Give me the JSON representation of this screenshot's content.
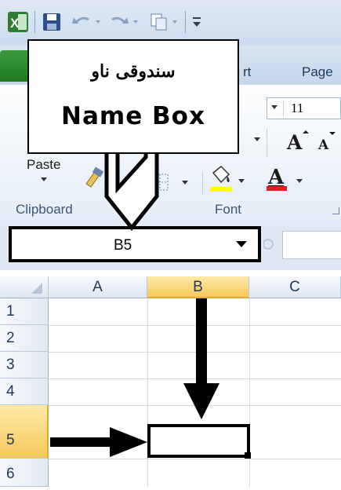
{
  "ribbon": {
    "tabs": [
      "rt",
      "Page"
    ],
    "font_size": "11",
    "paste_label": "Paste",
    "groups": [
      "Clipboard",
      "Font"
    ]
  },
  "callout": {
    "kurdish": "سندوقی ناو",
    "english": "Name Box"
  },
  "name_box": {
    "value": "B5"
  },
  "grid": {
    "columns": [
      "A",
      "B",
      "C"
    ],
    "rows": [
      "1",
      "2",
      "3",
      "4",
      "5",
      "6"
    ],
    "selected_column": "B",
    "selected_row": "5"
  },
  "colors": {
    "excel_green": "#1f7a1f",
    "selection_header": "#f6c95a",
    "annotation": "#000000"
  }
}
